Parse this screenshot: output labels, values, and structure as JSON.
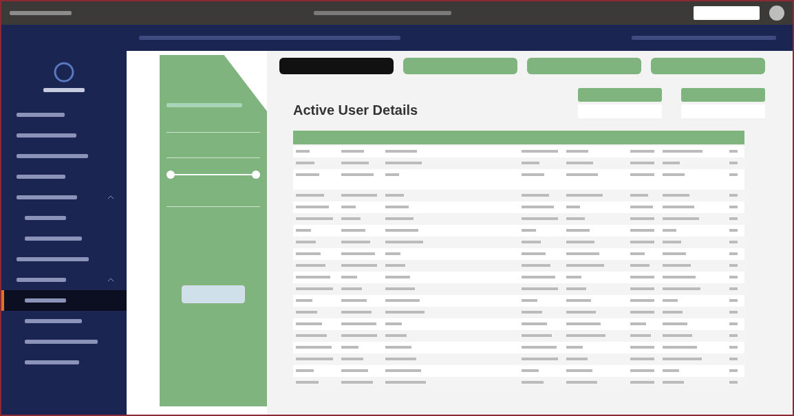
{
  "page": {
    "title": "Active User Details"
  },
  "sidebar": {
    "items": [
      {
        "selected": false
      },
      {
        "selected": false
      },
      {
        "selected": false
      },
      {
        "selected": false
      },
      {
        "selected": false,
        "expanded": true,
        "children": [
          {
            "selected": false
          },
          {
            "selected": false
          }
        ]
      },
      {
        "selected": false
      },
      {
        "selected": false,
        "expanded": true,
        "children": [
          {
            "selected": true
          },
          {
            "selected": false
          },
          {
            "selected": false
          },
          {
            "selected": false
          }
        ]
      }
    ]
  },
  "nav_buttons": [
    {
      "selected": true
    },
    {
      "selected": false
    },
    {
      "selected": false
    },
    {
      "selected": false
    }
  ],
  "table": {
    "rows": [
      {
        "kind": "normal"
      },
      {
        "kind": "normal"
      },
      {
        "kind": "tall"
      },
      {
        "kind": "normal"
      },
      {
        "kind": "normal"
      },
      {
        "kind": "normal"
      },
      {
        "kind": "normal"
      },
      {
        "kind": "normal"
      },
      {
        "kind": "normal"
      },
      {
        "kind": "normal"
      },
      {
        "kind": "normal"
      },
      {
        "kind": "normal"
      },
      {
        "kind": "normal"
      },
      {
        "kind": "normal"
      },
      {
        "kind": "normal"
      },
      {
        "kind": "normal"
      },
      {
        "kind": "normal"
      },
      {
        "kind": "normal"
      },
      {
        "kind": "normal"
      },
      {
        "kind": "normal"
      }
    ]
  }
}
